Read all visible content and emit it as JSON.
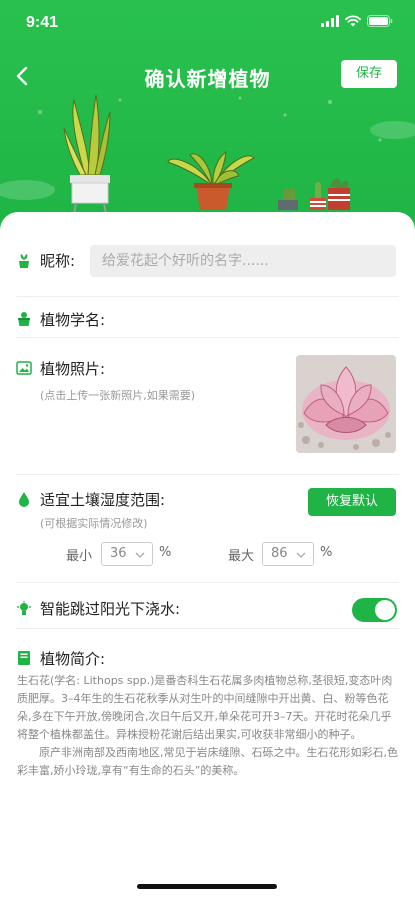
{
  "status_bar": {
    "time": "9:41"
  },
  "nav": {
    "title": "确认新增植物",
    "save_label": "保存"
  },
  "form": {
    "nickname": {
      "label": "昵称:",
      "placeholder": "给爱花起个好听的名字......",
      "value": ""
    },
    "scientific_name": {
      "label": "植物学名:",
      "value": ""
    },
    "photo": {
      "label": "植物照片:",
      "hint": "(点击上传一张新照片,如果需要)"
    },
    "humidity": {
      "label": "适宜土壤湿度范围:",
      "hint": "(可根据实际情况修改)",
      "restore_label": "恢复默认",
      "min_label": "最小",
      "min_value": "36",
      "max_label": "最大",
      "max_value": "86",
      "unit": "%"
    },
    "skip_sun": {
      "label": "智能跳过阳光下浇水:",
      "enabled": true
    },
    "intro": {
      "label": "植物简介:",
      "paragraph1": "生石花(学名: Lithops spp.)是番杏科生石花属多肉植物总称,茎很短,变态叶肉质肥厚。3–4年生的生石花秋季从对生叶的中间缝隙中开出黄、白、粉等色花朵,多在下午开放,傍晚闭合,次日午后又开,单朵花可开3–7天。开花时花朵几乎将整个植株都盖住。异株授粉花谢后结出果实,可收获非常细小的种子。",
      "paragraph2": "原产非洲南部及西南地区,常见于岩床缝隙、石砾之中。生石花形如彩石,色彩丰富,娇小玲珑,享有“有生命的石头”的美称。"
    }
  },
  "colors": {
    "brand_green": "#1fb445",
    "header_green": "#29c14e"
  }
}
